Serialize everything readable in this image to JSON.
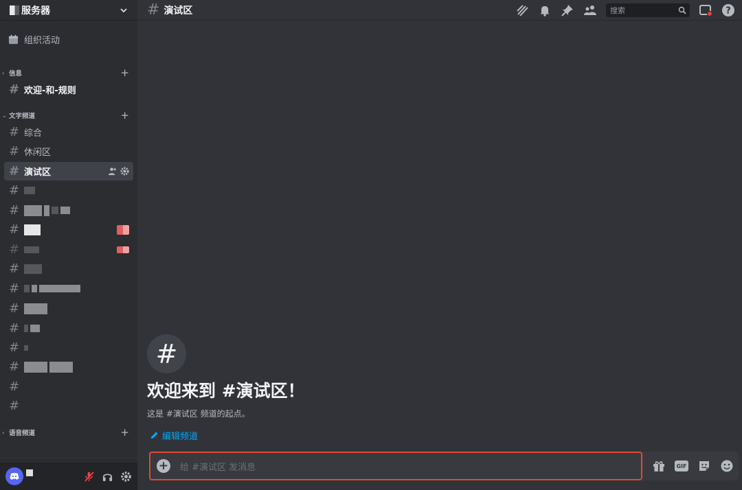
{
  "server": {
    "name": "服务器"
  },
  "sidebar": {
    "events_label": "组织活动",
    "categories": [
      {
        "label": "信息"
      },
      {
        "label": "文字频道"
      },
      {
        "label": "语音频道"
      }
    ],
    "channels": [
      {
        "label": "欢迎-和-规则"
      },
      {
        "label": "综合"
      },
      {
        "label": "休闲区"
      },
      {
        "label": "演试区"
      }
    ]
  },
  "topbar": {
    "channel": "演试区",
    "search_placeholder": "搜索"
  },
  "welcome": {
    "title": "欢迎来到 #演试区！",
    "subtitle": "这是 #演试区 频道的起点。",
    "edit_label": "编辑频道"
  },
  "composer": {
    "placeholder": "给 #演试区 发消息",
    "gif_label": "GIF"
  },
  "colors": {
    "accent": "#5865f2",
    "link": "#00a8fc",
    "highlight_border": "#e14b2f",
    "status_red": "#f23f43"
  }
}
